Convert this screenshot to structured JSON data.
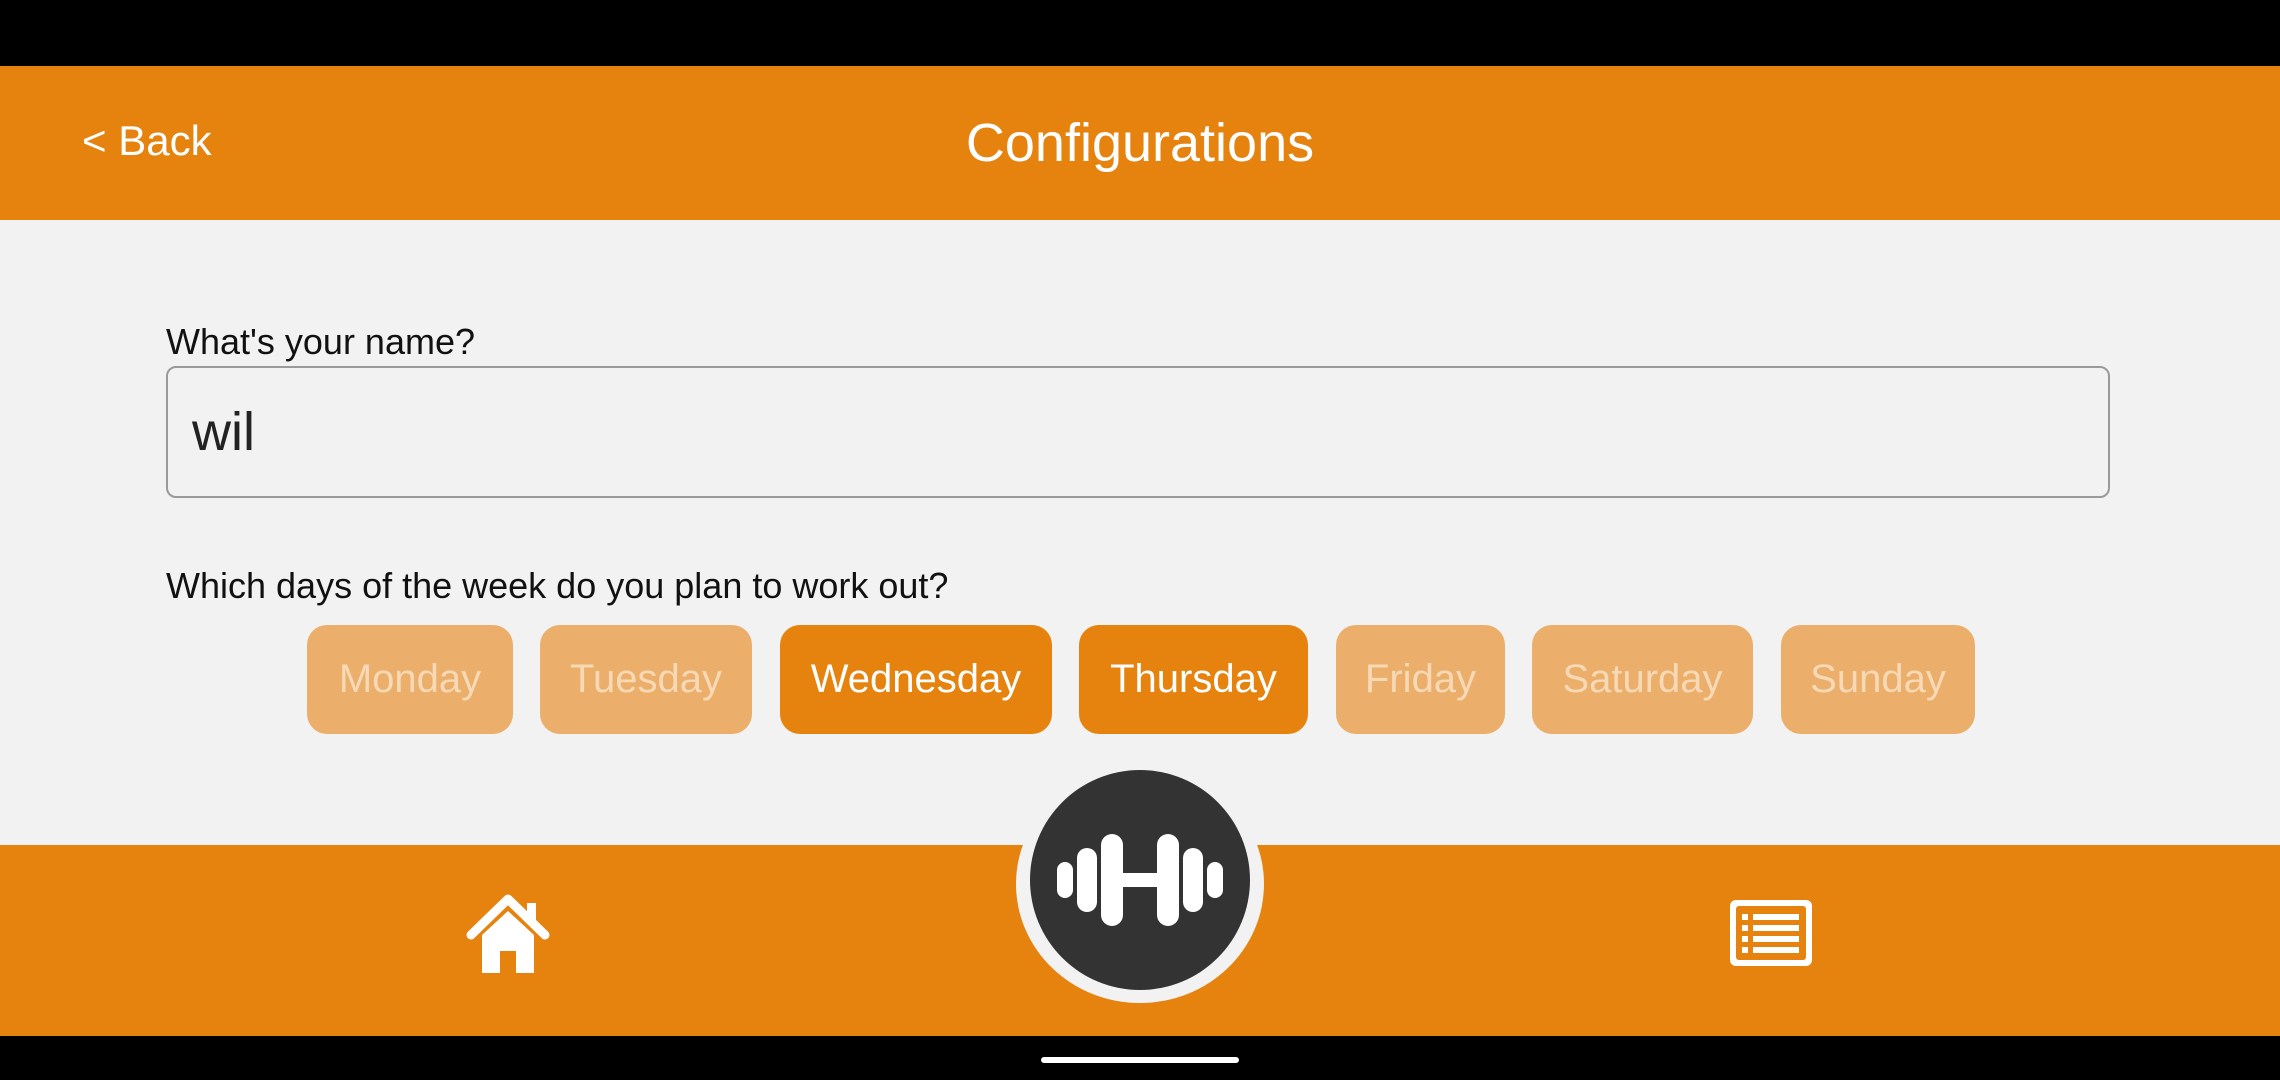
{
  "header": {
    "back_label": "< Back",
    "title": "Configurations"
  },
  "form": {
    "name_question": "What's your name?",
    "name_value": "wil",
    "days_question": "Which days of the week do you plan to work out?"
  },
  "days": [
    {
      "label": "Monday",
      "selected": false
    },
    {
      "label": "Tuesday",
      "selected": false
    },
    {
      "label": "Wednesday",
      "selected": true
    },
    {
      "label": "Thursday",
      "selected": true
    },
    {
      "label": "Friday",
      "selected": false
    },
    {
      "label": "Saturday",
      "selected": false
    },
    {
      "label": "Sunday",
      "selected": false
    }
  ],
  "bottom_nav": {
    "left_icon": "home-icon",
    "center_icon": "dumbbell-icon",
    "right_icon": "list-icon"
  },
  "colors": {
    "accent": "#E6820E",
    "accent_unselected": "#EBAF6B",
    "background": "#F2F2F2",
    "fab": "#333333"
  }
}
